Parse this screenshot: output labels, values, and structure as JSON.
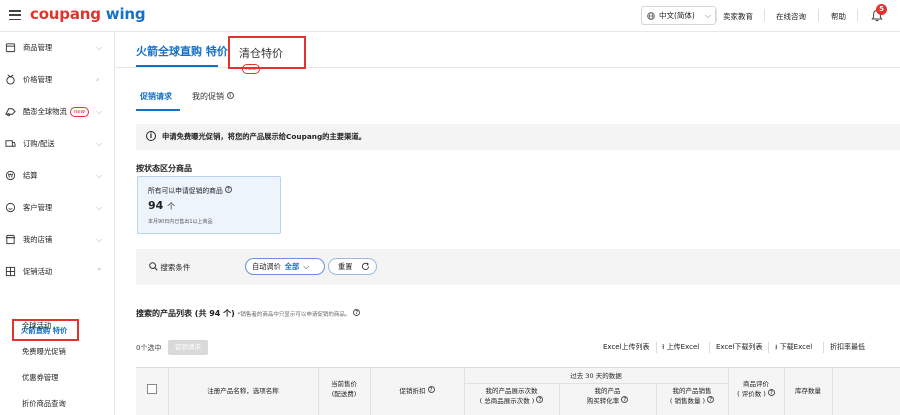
{
  "header": {
    "logo_part1": "coupang",
    "logo_part2": "wing",
    "language": "中文(简体)",
    "links": [
      "卖家教育",
      "在线咨询",
      "帮助"
    ],
    "notification_count": "5"
  },
  "sidebar": {
    "items": [
      {
        "label": "商品管理",
        "icon": "box-icon"
      },
      {
        "label": "价格管理",
        "icon": "price-tag-icon"
      },
      {
        "label": "酷澎全球物流",
        "icon": "truck-icon",
        "tag": "new"
      },
      {
        "label": "订购/配送",
        "icon": "delivery-icon"
      },
      {
        "label": "结算",
        "icon": "settlement-icon"
      },
      {
        "label": "客户管理",
        "icon": "customer-icon"
      },
      {
        "label": "我的店铺",
        "icon": "store-icon"
      },
      {
        "label": "促销活动",
        "icon": "promotion-icon"
      }
    ],
    "sub_items": [
      "火箭直购 特价",
      "全球活动",
      "免费曝光促销",
      "优惠券管理",
      "折价商品查询"
    ]
  },
  "tabs": {
    "main": "火箭全球直购 特价",
    "clearance": "清仓特价",
    "new_tag": "new"
  },
  "subtabs": {
    "active": "促销请求",
    "other": "我的促销"
  },
  "notice": "申请免费曝光促销，将您的产品展示给Coupang的主要渠道。",
  "status_section": {
    "title": "按状态区分商品",
    "card_title": "所有可以申请促销的商品",
    "count": "94",
    "count_unit": "个",
    "card_sub": "本月90日内已售出1以上商品"
  },
  "filter": {
    "label": "搜索条件",
    "auto_price": "自动调价",
    "auto_price_value": "全部",
    "reset": "重置"
  },
  "list": {
    "title": "搜索的产品列表 (共 94 个)",
    "note": "*销售者的商品中只显示可以申请促销的商品。",
    "selected": "0个选中",
    "request_button": "促销请求",
    "toolbar": [
      "Excel上传列表",
      "上传Excel",
      "Excel下载列表",
      "下载Excel",
      "折扣率最低"
    ]
  },
  "table": {
    "group_header": "过去 30 天的数据",
    "col_name": "注册产品名称，选项名称",
    "col_price_1": "当前售价",
    "col_price_2": "(配送费)",
    "col_discount": "促销折扣",
    "col_impr_1": "我的产品展示次数",
    "col_impr_2": "( 总商品展示次数 )",
    "col_conv_1": "我的产品",
    "col_conv_2": "购买转化率",
    "col_sales_1": "我的产品销售",
    "col_sales_2": "( 销售数量 )",
    "col_rating_1": "商品评价",
    "col_rating_2": "( 评价数 )",
    "col_stock": "库存数量"
  }
}
